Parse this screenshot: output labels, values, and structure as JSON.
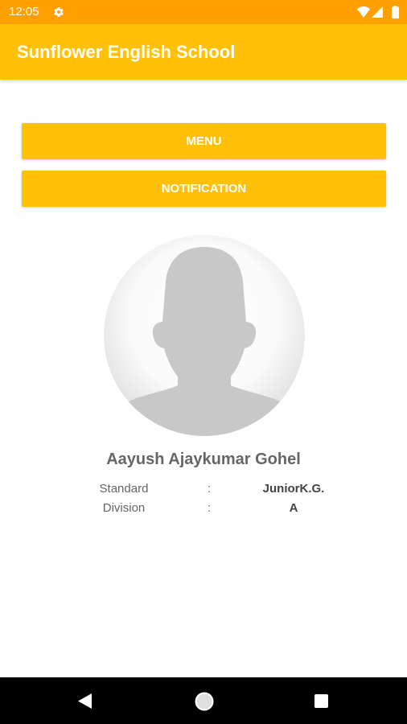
{
  "status_bar": {
    "time": "12:05",
    "icons": [
      "gear-icon",
      "wifi-icon",
      "signal-icon",
      "battery-icon"
    ],
    "background": "#ffa000"
  },
  "app_bar": {
    "title": "Sunflower English School",
    "background": "#ffc107"
  },
  "buttons": {
    "menu_label": "MENU",
    "notification_label": "NOTIFICATION"
  },
  "profile": {
    "avatar_icon": "default-person-avatar-icon",
    "name": "Aayush Ajaykumar Gohel",
    "fields": [
      {
        "label": "Standard",
        "separator": ":",
        "value": "JuniorK.G."
      },
      {
        "label": "Division",
        "separator": ":",
        "value": "A"
      }
    ]
  },
  "nav_bar": {
    "icons": [
      "back-icon",
      "home-icon",
      "recents-icon"
    ]
  }
}
